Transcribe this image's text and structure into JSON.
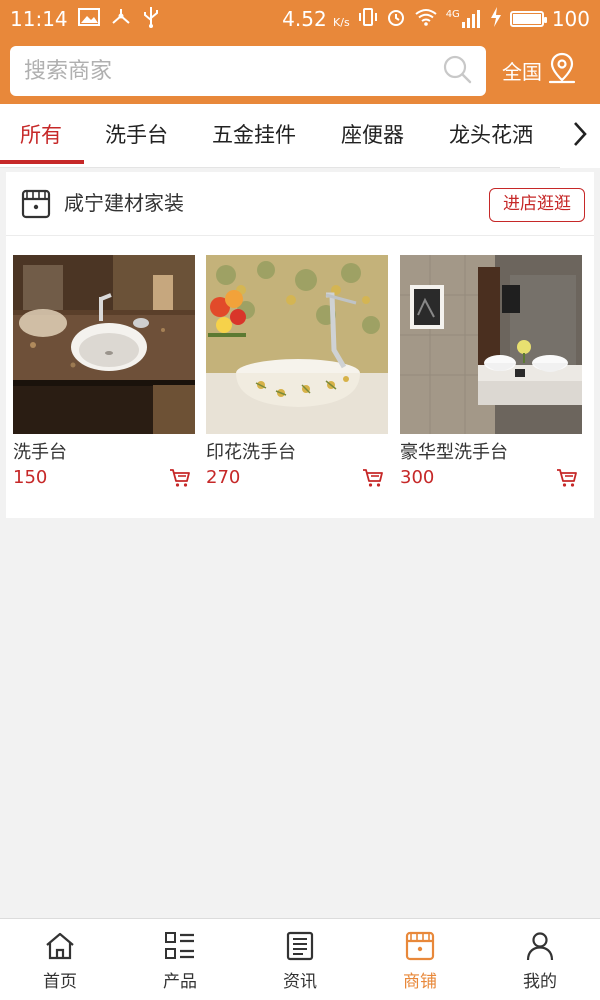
{
  "status_bar": {
    "time": "11:14",
    "network_speed": "4.52",
    "speed_unit": "K/s",
    "signal_type": "4G",
    "battery": "100",
    "battery_level": 1.0
  },
  "header": {
    "search_placeholder": "搜索商家",
    "region_label": "全国"
  },
  "tabs": [
    {
      "label": "所有",
      "active": true
    },
    {
      "label": "洗手台",
      "active": false
    },
    {
      "label": "五金挂件",
      "active": false
    },
    {
      "label": "座便器",
      "active": false
    },
    {
      "label": "龙头花洒",
      "active": false
    }
  ],
  "shop": {
    "name": "咸宁建材家装",
    "visit_label": "进店逛逛",
    "products": [
      {
        "name": "洗手台",
        "price": "150"
      },
      {
        "name": "印花洗手台",
        "price": "270"
      },
      {
        "name": "豪华型洗手台",
        "price": "300"
      }
    ]
  },
  "bottom_nav": [
    {
      "label": "首页",
      "icon": "home-icon",
      "active": false
    },
    {
      "label": "产品",
      "icon": "product-list-icon",
      "active": false
    },
    {
      "label": "资讯",
      "icon": "news-icon",
      "active": false
    },
    {
      "label": "商铺",
      "icon": "store-icon",
      "active": true
    },
    {
      "label": "我的",
      "icon": "user-icon",
      "active": false
    }
  ],
  "colors": {
    "accent_orange": "#e8883a",
    "accent_red": "#c62828",
    "background": "#f2f2f2"
  }
}
